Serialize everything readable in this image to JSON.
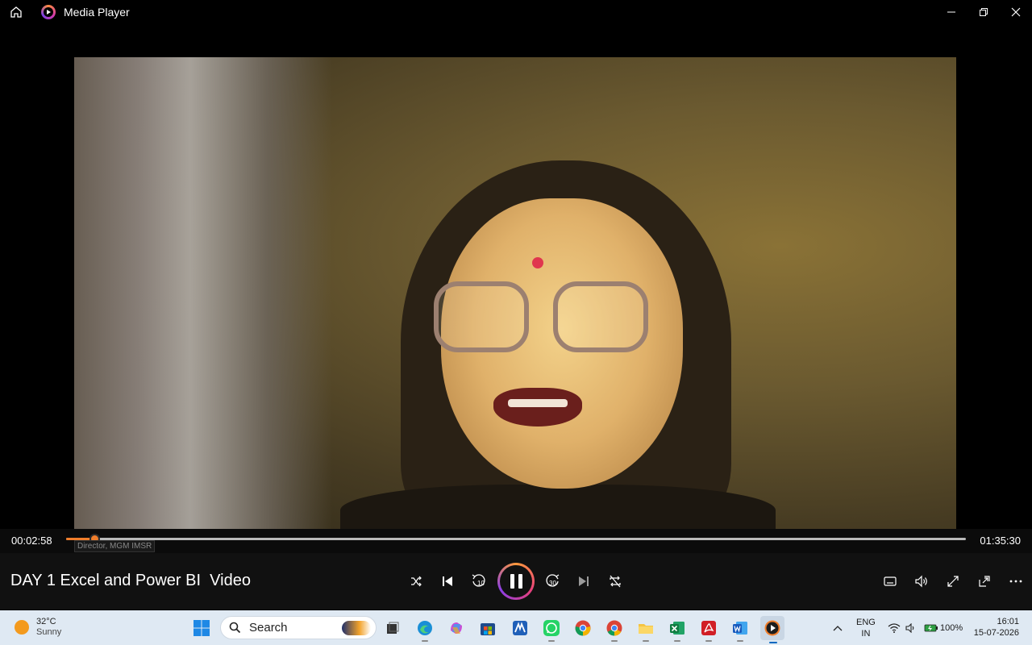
{
  "app": {
    "title": "Media Player"
  },
  "window_controls": {
    "minimize_icon": "minimize-icon",
    "restore_icon": "restore-icon",
    "close_icon": "close-icon"
  },
  "video": {
    "caption_tooltip": "Director, MGM IMSR"
  },
  "playback": {
    "current_time": "00:02:58",
    "total_time": "01:35:30",
    "progress_fraction": 0.031,
    "accent": "#f07d2b"
  },
  "media": {
    "title": "DAY 1 Excel and Power BI  Video"
  },
  "controls": {
    "shuffle": "shuffle-icon",
    "previous": "previous-icon",
    "rewind_label": "10",
    "play_pause": "pause-icon",
    "forward_label": "30",
    "next": "next-icon",
    "repeat": "repeat-off-icon",
    "subtitles": "subtitles-icon",
    "volume": "volume-icon",
    "fullscreen": "fullscreen-icon",
    "miniplayer": "miniplayer-icon",
    "more": "more-icon"
  },
  "taskbar": {
    "weather_temp": "32°C",
    "weather_cond": "Sunny",
    "search_label": "Search",
    "apps": [
      "start",
      "search",
      "task-view",
      "edge",
      "copilot",
      "store",
      "ms-app",
      "whatsapp",
      "chrome",
      "chrome-2",
      "file-explorer",
      "excel",
      "acrobat",
      "word",
      "media-player"
    ]
  },
  "tray": {
    "lang_line1": "ENG",
    "lang_line2": "IN",
    "battery": "100%",
    "time": "16:01",
    "date": "15-07-2026"
  }
}
